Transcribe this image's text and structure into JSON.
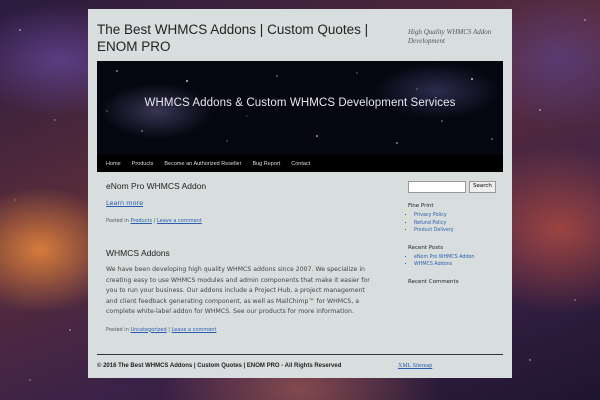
{
  "site": {
    "title": "The Best WHMCS Addons | Custom Quotes | ENOM PRO",
    "description": "High Quality WHMCS Addon Development"
  },
  "banner": {
    "text": "WHMCS Addons & Custom WHMCS Development Services"
  },
  "nav": {
    "items": [
      "Home",
      "Products",
      "Become an Authorized Reseller",
      "Bug Report",
      "Contact"
    ]
  },
  "posts": [
    {
      "title": "eNom Pro WHMCS Addon",
      "link": "Learn more",
      "meta_prefix": "Posted in",
      "category": "Products",
      "separator": "|",
      "comment": "Leave a comment"
    },
    {
      "title": "WHMCS Addons",
      "body": "We have been developing high quality WHMCS addons since 2007. We specialize in creating easy to use WHMCS modules and admin components that make it easier for you to run your business. Our addons include a Project Hub, a project management and client feedback generating component, as well as MailChimp™ for WHMCS, a complete white-label addon for WHMCS. See our products for more information.",
      "meta_prefix": "Posted in",
      "category": "Uncategorized",
      "separator": "|",
      "comment": "Leave a comment"
    }
  ],
  "sidebar": {
    "search_button": "Search",
    "search_value": "",
    "fine_print": {
      "title": "Fine Print",
      "items": [
        "Privacy Policy",
        "Refund Policy",
        "Product Delivery"
      ]
    },
    "recent_posts": {
      "title": "Recent Posts",
      "items": [
        "eNom Pro WHMCS Addon",
        "WHMCS Addons"
      ]
    },
    "recent_comments": {
      "title": "Recent Comments"
    }
  },
  "footer": {
    "copyright": "© 2016 The Best WHMCS Addons | Custom Quotes | ENOM PRO - All Rights Reserved",
    "sitemap": "XML Sitemap"
  },
  "colors": {
    "link": "#2a5db0",
    "nav_bg": "#000000",
    "page_bg": "#d8dede"
  }
}
